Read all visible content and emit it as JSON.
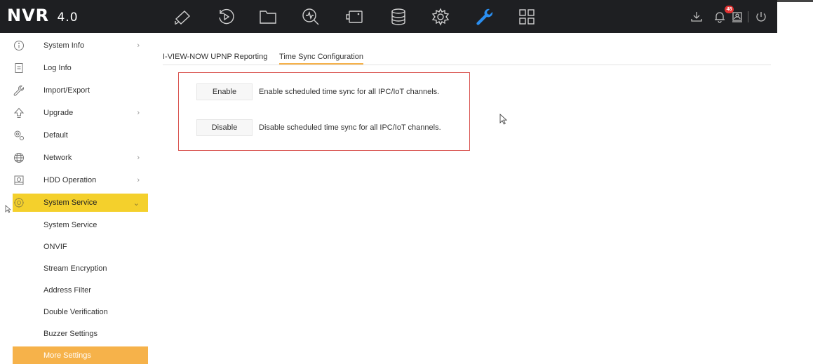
{
  "app": {
    "logo_main": "NVR",
    "logo_version": "4.0"
  },
  "topnav": [
    {
      "icon": "camera-icon"
    },
    {
      "icon": "playback-icon"
    },
    {
      "icon": "folder-icon"
    },
    {
      "icon": "smart-search-icon"
    },
    {
      "icon": "display-icon"
    },
    {
      "icon": "storage-icon"
    },
    {
      "icon": "configuration-icon"
    },
    {
      "icon": "maintenance-wrench-icon"
    },
    {
      "icon": "grid-layout-icon"
    }
  ],
  "topright": {
    "alarm_count": "48",
    "icons": [
      "download-icon",
      "alarm-bell-icon",
      "user-icon",
      "power-icon"
    ]
  },
  "colors": {
    "topbar": "#1e1f22",
    "active_wrench": "#2a8ef0",
    "active_menu": "#f4d02c",
    "accent_orange": "#f6b24a",
    "box_border": "#d9534f"
  },
  "sidebar": {
    "items": [
      {
        "label": "System Info",
        "icon": "info-icon",
        "has_children": true
      },
      {
        "label": "Log Info",
        "icon": "log-icon",
        "has_children": false
      },
      {
        "label": "Import/Export",
        "icon": "wrench-icon",
        "has_children": false
      },
      {
        "label": "Upgrade",
        "icon": "upgrade-arrow-icon",
        "has_children": true
      },
      {
        "label": "Default",
        "icon": "default-gears-icon",
        "has_children": false
      },
      {
        "label": "Network",
        "icon": "globe-icon",
        "has_children": true
      },
      {
        "label": "HDD Operation",
        "icon": "hdd-icon",
        "has_children": true
      },
      {
        "label": "System Service",
        "icon": "system-service-icon",
        "has_children": true,
        "active": true
      }
    ],
    "sub_items": [
      {
        "label": "System Service"
      },
      {
        "label": "ONVIF"
      },
      {
        "label": "Stream Encryption"
      },
      {
        "label": "Address Filter"
      },
      {
        "label": "Double Verification"
      },
      {
        "label": "Buzzer Settings"
      },
      {
        "label": "More Settings",
        "selected": true
      }
    ]
  },
  "tabs": [
    {
      "label": "I-VIEW-NOW UPNP Reporting"
    },
    {
      "label": "Time Sync Configuration",
      "active": true
    }
  ],
  "time_sync": {
    "enable_button": "Enable",
    "enable_desc": "Enable scheduled time sync for all IPC/IoT channels.",
    "disable_button": "Disable",
    "disable_desc": "Disable scheduled time sync for all IPC/IoT channels."
  }
}
